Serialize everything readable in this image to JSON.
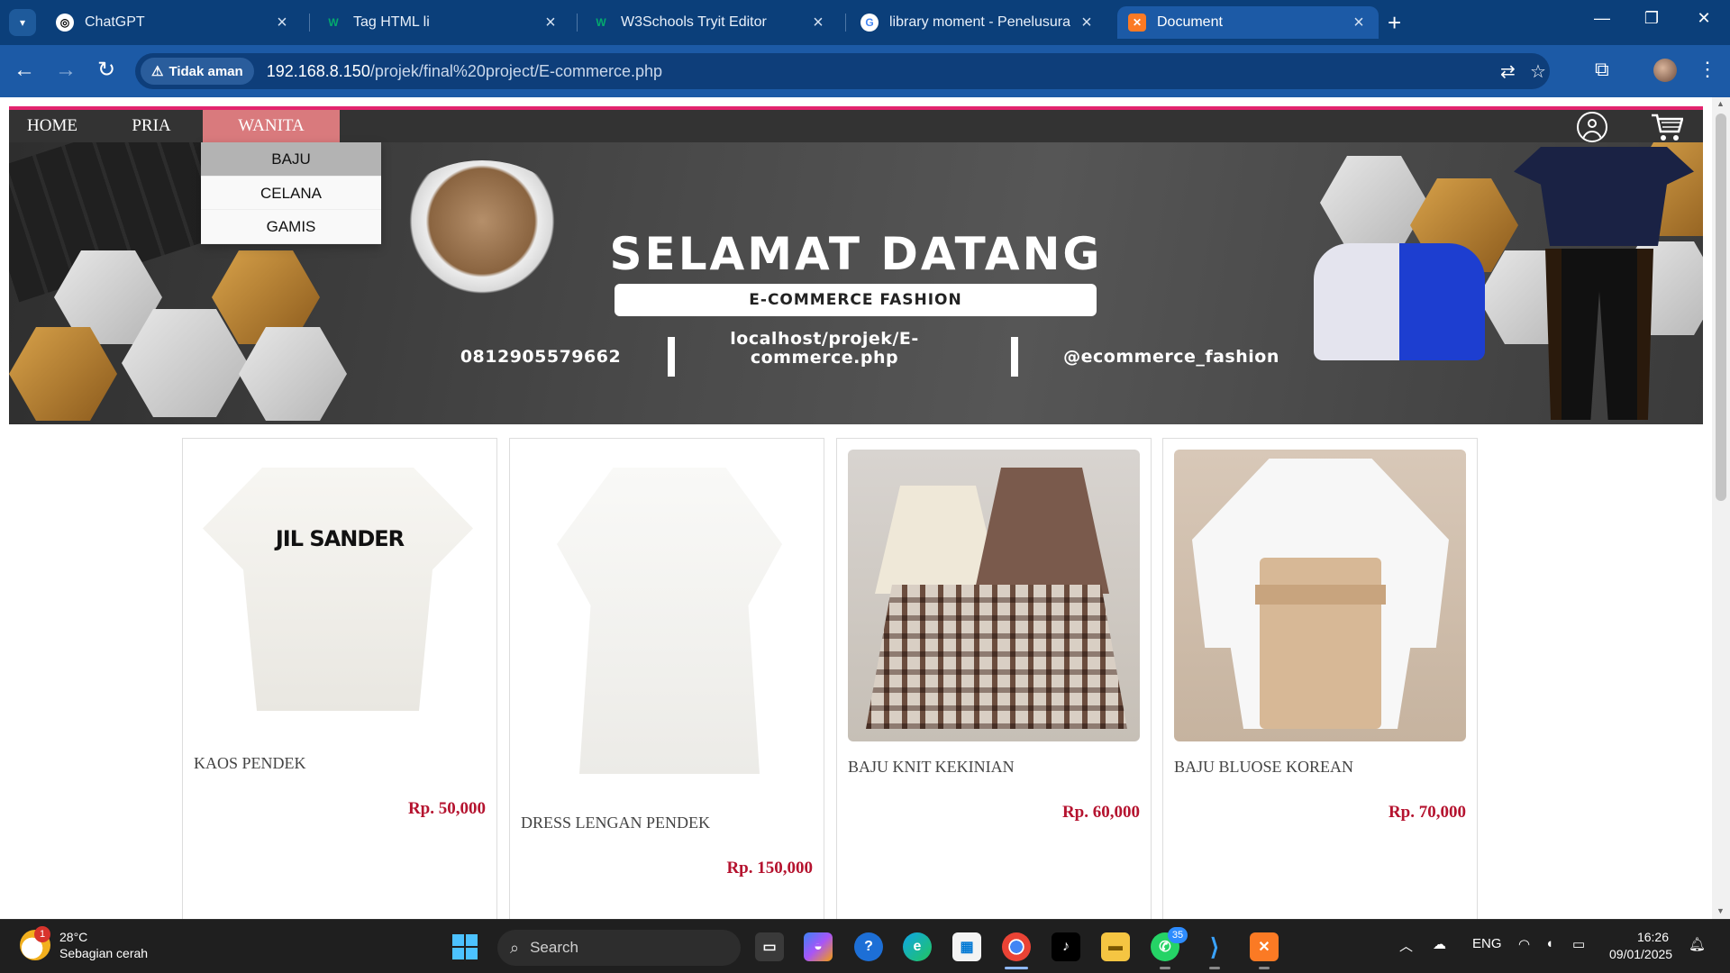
{
  "browser": {
    "tabs": [
      {
        "title": "ChatGPT",
        "icon": "chatgpt-icon",
        "active": false
      },
      {
        "title": "Tag HTML li",
        "icon": "w3schools-icon",
        "active": false
      },
      {
        "title": "W3Schools Tryit Editor",
        "icon": "w3schools-icon",
        "active": false
      },
      {
        "title": "library moment - Penelusuran G",
        "icon": "google-icon",
        "active": false
      },
      {
        "title": "Document",
        "icon": "xampp-icon",
        "active": true
      }
    ],
    "security_label": "Tidak aman",
    "url_host": "192.168.8.150",
    "url_path": "/projek/final%20project/E-commerce.php"
  },
  "nav": {
    "items": [
      "HOME",
      "PRIA",
      "WANITA"
    ],
    "active": "WANITA",
    "dropdown": [
      "BAJU",
      "CELANA",
      "GAMIS"
    ],
    "dropdown_hover": "BAJU"
  },
  "banner": {
    "title": "SELAMAT DATANG",
    "subtitle": "E-COMMERCE FASHION",
    "phone": "0812905579662",
    "site_line1": "localhost/projek/E-",
    "site_line2": "commerce.php",
    "instagram": "@ecommerce_fashion"
  },
  "products": [
    {
      "name": "KAOS PENDEK",
      "price": "Rp. 50,000",
      "image_label": "JIL SANDER"
    },
    {
      "name": "DRESS LENGAN PENDEK",
      "price": "Rp. 150,000"
    },
    {
      "name": "BAJU KNIT KEKINIAN",
      "price": "Rp. 60,000"
    },
    {
      "name": "BAJU BLUOSE KOREAN",
      "price": "Rp. 70,000"
    }
  ],
  "taskbar": {
    "weather_temp": "28°C",
    "weather_desc": "Sebagian cerah",
    "weather_badge": "1",
    "search_placeholder": "Search",
    "whatsapp_badge": "35",
    "language": "ENG",
    "time": "16:26",
    "date": "09/01/2025"
  },
  "colors": {
    "nav_accent": "#e3246e",
    "nav_active": "#d97a7d",
    "price": "#b5132f",
    "chrome_frame": "#0b3f7a"
  }
}
